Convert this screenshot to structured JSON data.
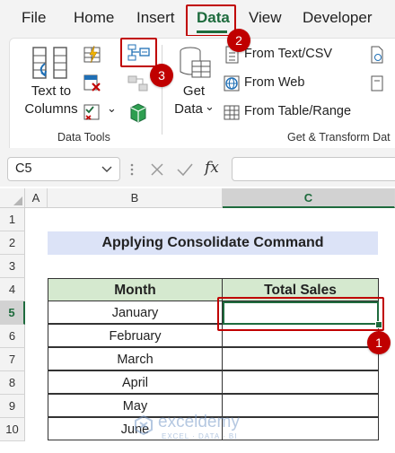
{
  "menu": {
    "file": "File",
    "home": "Home",
    "insert": "Insert",
    "data": "Data",
    "view": "View",
    "developer": "Developer"
  },
  "ribbon": {
    "text_to_columns_line1": "Text to",
    "text_to_columns_line2": "Columns",
    "data_tools_label": "Data Tools",
    "get_data_line1": "Get",
    "get_data_line2": "Data",
    "dropdown_caret": "⌄",
    "from_text_csv": "From Text/CSV",
    "from_web": "From Web",
    "from_table_range": "From Table/Range",
    "get_transform_label": "Get & Transform Dat"
  },
  "formula_bar": {
    "name_box": "C5",
    "fx": "fx",
    "formula": ""
  },
  "grid": {
    "columns": [
      "A",
      "B",
      "C"
    ],
    "rows": [
      "1",
      "2",
      "3",
      "4",
      "5",
      "6",
      "7",
      "8",
      "9",
      "10"
    ],
    "title": "Applying Consolidate Command",
    "header_month": "Month",
    "header_total_sales": "Total Sales",
    "months": [
      "January",
      "February",
      "March",
      "April",
      "May",
      "June"
    ]
  },
  "annotations": {
    "step1": "1",
    "step2": "2",
    "step3": "3"
  },
  "watermark": {
    "brand": "exceldemy",
    "tagline": "EXCEL · DATA · BI"
  },
  "colors": {
    "excel_green": "#1e6b3d",
    "annotation_red": "#c00000",
    "title_fill": "#dce3f7",
    "header_fill": "#d5e9cf"
  }
}
